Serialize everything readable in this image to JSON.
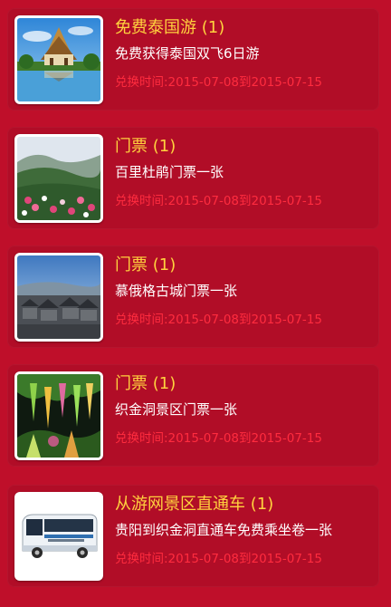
{
  "colors": {
    "background": "#bf0f2a",
    "card": "#b10d27",
    "title": "#ffd23e",
    "desc": "#ffffff",
    "date": "#ff2c3f"
  },
  "items": [
    {
      "title": "免费泰国游 (1)",
      "desc": "免费获得泰国双飞6日游",
      "date": "兑换时间:2015-07-08到2015-07-15",
      "image": "thai-temple-image"
    },
    {
      "title": "门票 (1)",
      "desc": "百里杜鹃门票一张",
      "date": "兑换时间:2015-07-08到2015-07-15",
      "image": "azalea-hills-image"
    },
    {
      "title": "门票 (1)",
      "desc": "慕俄格古城门票一张",
      "date": "兑换时间:2015-07-08到2015-07-15",
      "image": "ancient-town-image"
    },
    {
      "title": "门票 (1)",
      "desc": "织金洞景区门票一张",
      "date": "兑换时间:2015-07-08到2015-07-15",
      "image": "cave-image"
    },
    {
      "title": "从游网景区直通车 (1)",
      "desc": "贵阳到织金洞直通车免费乘坐卷一张",
      "date": "兑换时间:2015-07-08到2015-07-15",
      "image": "bus-image"
    }
  ]
}
